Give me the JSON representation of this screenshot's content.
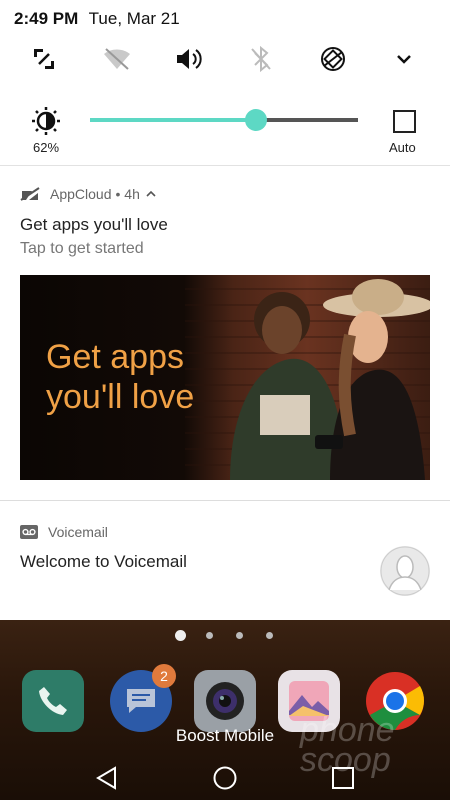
{
  "status": {
    "time": "2:49 PM",
    "date": "Tue, Mar 21"
  },
  "quick_settings": [
    "screenshot-icon",
    "wifi-off-icon",
    "volume-icon",
    "bluetooth-off-icon",
    "auto-rotate-icon",
    "expand-chevron-icon"
  ],
  "brightness": {
    "percent_label": "62%",
    "level": 0.62,
    "auto_label": "Auto",
    "accent": "#5dd8c4"
  },
  "notifications": [
    {
      "app": "AppCloud",
      "meta": "• 4h",
      "title": "Get apps you'll love",
      "subtitle": "Tap to get started",
      "banner_text_1": "Get apps",
      "banner_text_2": "you'll love"
    },
    {
      "app": "Voicemail",
      "title": "Welcome to Voicemail"
    }
  ],
  "home": {
    "badge_count": "2",
    "carrier": "Boost Mobile",
    "dock": [
      "phone-icon",
      "messages-icon",
      "camera-icon",
      "gallery-icon",
      "chrome-icon"
    ],
    "watermark_1": "phone",
    "watermark_2": "scoop"
  },
  "nav": [
    "back-icon",
    "home-icon",
    "recents-icon"
  ]
}
